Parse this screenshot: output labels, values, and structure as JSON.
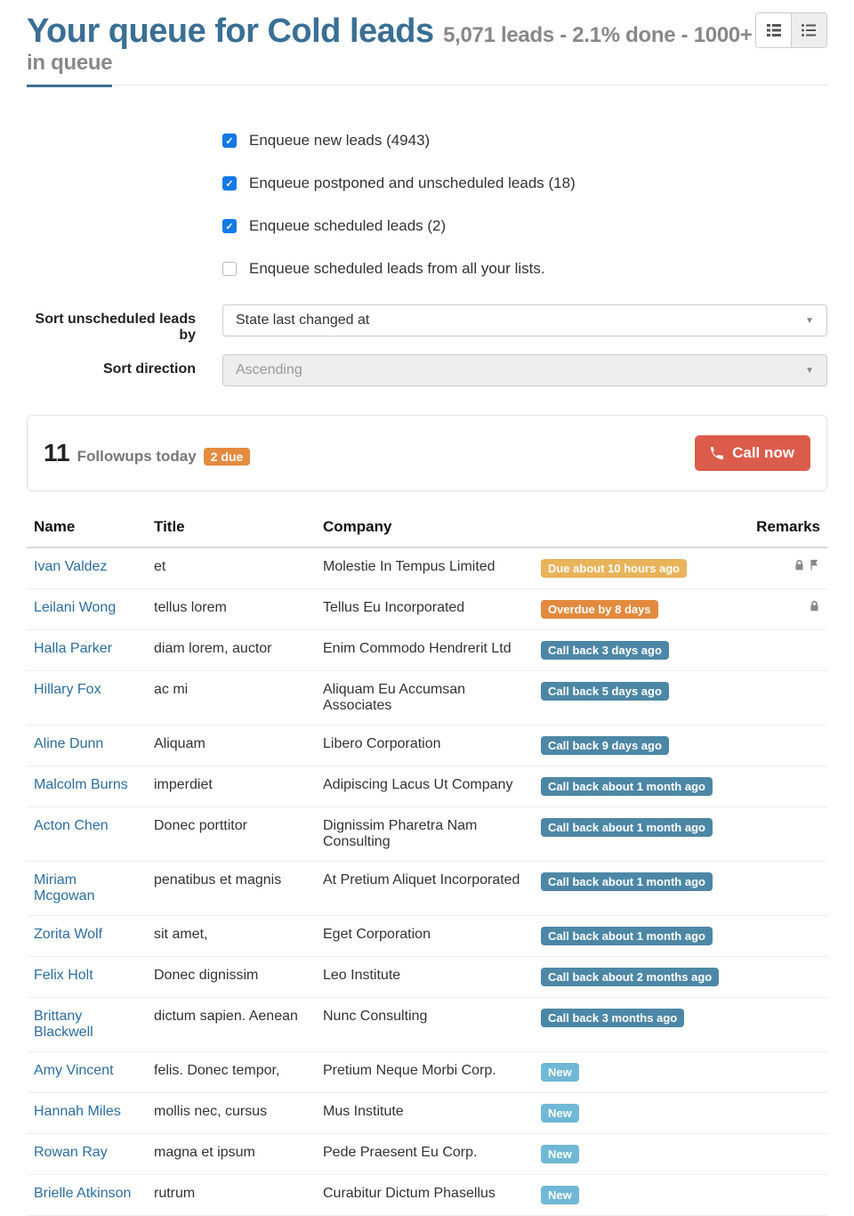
{
  "header": {
    "title": "Your queue for Cold leads",
    "subtitle": "5,071 leads - 2.1% done - 1000+ in queue"
  },
  "checks": {
    "new_leads": "Enqueue new leads (4943)",
    "postponed": "Enqueue postponed and unscheduled leads (18)",
    "scheduled": "Enqueue scheduled leads (2)",
    "all_lists": "Enqueue scheduled leads from all your lists."
  },
  "labels": {
    "sort_unscheduled": "Sort unscheduled leads by",
    "sort_direction": "Sort direction"
  },
  "selects": {
    "sort_unscheduled": "State last changed at",
    "sort_direction": "Ascending"
  },
  "followups": {
    "count": "11",
    "text": "Followups today",
    "due_badge": "2 due",
    "call_now": "Call now"
  },
  "table": {
    "headers": {
      "name": "Name",
      "title": "Title",
      "company": "Company",
      "remarks": "Remarks"
    }
  },
  "rows": [
    {
      "name": "Ivan Valdez",
      "title": "et",
      "company": "Molestie In Tempus Limited",
      "status": "Due about 10 hours ago",
      "cls": "s-due",
      "icons": [
        "lock",
        "flag"
      ]
    },
    {
      "name": "Leilani Wong",
      "title": "tellus lorem",
      "company": "Tellus Eu Incorporated",
      "status": "Overdue by 8 days",
      "cls": "s-overdue",
      "icons": [
        "lock"
      ]
    },
    {
      "name": "Halla Parker",
      "title": "diam lorem, auctor",
      "company": "Enim Commodo Hendrerit Ltd",
      "status": "Call back 3 days ago",
      "cls": "s-callback",
      "icons": []
    },
    {
      "name": "Hillary Fox",
      "title": "ac mi",
      "company": "Aliquam Eu Accumsan Associates",
      "status": "Call back 5 days ago",
      "cls": "s-callback",
      "icons": []
    },
    {
      "name": "Aline Dunn",
      "title": "Aliquam",
      "company": "Libero Corporation",
      "status": "Call back 9 days ago",
      "cls": "s-callback",
      "icons": []
    },
    {
      "name": "Malcolm Burns",
      "title": "imperdiet",
      "company": "Adipiscing Lacus Ut Company",
      "status": "Call back about 1 month ago",
      "cls": "s-callback",
      "icons": []
    },
    {
      "name": "Acton Chen",
      "title": "Donec porttitor",
      "company": "Dignissim Pharetra Nam Consulting",
      "status": "Call back about 1 month ago",
      "cls": "s-callback",
      "icons": []
    },
    {
      "name": "Miriam Mcgowan",
      "title": "penatibus et magnis",
      "company": "At Pretium Aliquet Incorporated",
      "status": "Call back about 1 month ago",
      "cls": "s-callback",
      "icons": []
    },
    {
      "name": "Zorita Wolf",
      "title": "sit amet,",
      "company": "Eget Corporation",
      "status": "Call back about 1 month ago",
      "cls": "s-callback",
      "icons": []
    },
    {
      "name": "Felix Holt",
      "title": "Donec dignissim",
      "company": "Leo Institute",
      "status": "Call back about 2 months ago",
      "cls": "s-callback",
      "icons": []
    },
    {
      "name": "Brittany Blackwell",
      "title": "dictum sapien. Aenean",
      "company": "Nunc Consulting",
      "status": "Call back 3 months ago",
      "cls": "s-callback",
      "icons": []
    },
    {
      "name": "Amy Vincent",
      "title": "felis. Donec tempor,",
      "company": "Pretium Neque Morbi Corp.",
      "status": "New",
      "cls": "s-new",
      "icons": []
    },
    {
      "name": "Hannah Miles",
      "title": "mollis nec, cursus",
      "company": "Mus Institute",
      "status": "New",
      "cls": "s-new",
      "icons": []
    },
    {
      "name": "Rowan Ray",
      "title": "magna et ipsum",
      "company": "Pede Praesent Eu Corp.",
      "status": "New",
      "cls": "s-new",
      "icons": []
    },
    {
      "name": "Brielle Atkinson",
      "title": "rutrum",
      "company": "Curabitur Dictum Phasellus",
      "status": "New",
      "cls": "s-new",
      "icons": []
    }
  ]
}
